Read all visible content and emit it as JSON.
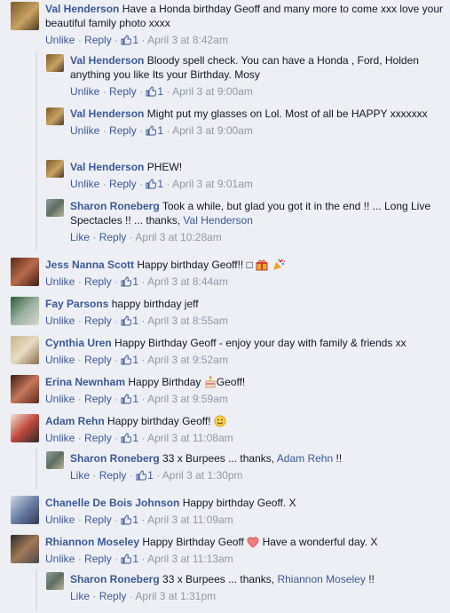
{
  "ui": {
    "like": "Like",
    "unlike": "Unlike",
    "reply": "Reply",
    "sep": "·"
  },
  "comments": [
    {
      "author": "Val Henderson",
      "text": "Have a Honda birthday Geoff and many more to come xxx love your beautiful family photo xxxx",
      "action": "Unlike",
      "likes": "1",
      "time": "April 3 at 8:42am"
    },
    {
      "author": "Val Henderson",
      "text": "Bloody spell check. You can have a Honda , Ford, Holden anything you like Its your Birthday. Mosy",
      "action": "Unlike",
      "likes": "1",
      "time": "April 3 at 9:00am"
    },
    {
      "author": "Val Henderson",
      "text": "Might put my glasses on Lol. Most of all be HAPPY xxxxxxx",
      "action": "Unlike",
      "likes": "1",
      "time": "April 3 at 9:00am"
    },
    {
      "author": "Val Henderson",
      "text": "PHEW!",
      "action": "Unlike",
      "likes": "1",
      "time": "April 3 at 9:01am"
    },
    {
      "author": "Sharon Roneberg",
      "text": "Took a while, but glad you got it in the end !! ... Long Live Spectacles !! ... thanks,",
      "mention": "Val Henderson",
      "action": "Like",
      "time": "April 3 at 10:28am"
    },
    {
      "author": "Jess Nanna Scott",
      "text": "Happy birthday Geoff!! □",
      "action": "Unlike",
      "likes": "1",
      "time": "April 3 at 8:44am"
    },
    {
      "author": "Fay Parsons",
      "text": "happy birthday jeff",
      "action": "Unlike",
      "likes": "1",
      "time": "April 3 at 8:55am"
    },
    {
      "author": "Cynthia Uren",
      "text": "Happy Birthday Geoff - enjoy your day with family & friends xx",
      "action": "Unlike",
      "likes": "1",
      "time": "April 3 at 9:52am"
    },
    {
      "author": "Erina Newnham",
      "text": "Happy Birthday",
      "text2": "Geoff!",
      "action": "Unlike",
      "likes": "1",
      "time": "April 3 at 9:59am"
    },
    {
      "author": "Adam Rehn",
      "text": "Happy birthday Geoff!",
      "action": "Unlike",
      "likes": "1",
      "time": "April 3 at 11:08am"
    },
    {
      "author": "Sharon Roneberg",
      "text": "33 x Burpees ... thanks,",
      "mention": "Adam Rehn",
      "tail": "!!",
      "action": "Like",
      "likes": "1",
      "time": "April 3 at 1:30pm"
    },
    {
      "author": "Chanelle De Bois Johnson",
      "text": "Happy birthday Geoff. X",
      "action": "Unlike",
      "likes": "1",
      "time": "April 3 at 11:09am"
    },
    {
      "author": "Rhiannon Moseley",
      "text": "Happy Birthday Geoff",
      "text2": "Have a wonderful day. X",
      "action": "Unlike",
      "likes": "1",
      "time": "April 3 at 11:13am"
    },
    {
      "author": "Sharon Roneberg",
      "text": "33 x Burpees ... thanks,",
      "mention": "Rhiannon Moseley",
      "tail": "!!",
      "action": "Like",
      "time": "April 3 at 1:31pm"
    }
  ],
  "colors": {
    "background": "#edeff4",
    "link": "#3b5998",
    "meta": "#9197a3",
    "rule": "#dcdee3"
  },
  "icons": [
    "thumbs-up-icon",
    "gift-icon",
    "party-popper-icon",
    "cake-icon",
    "smile-icon",
    "heart-icon"
  ]
}
